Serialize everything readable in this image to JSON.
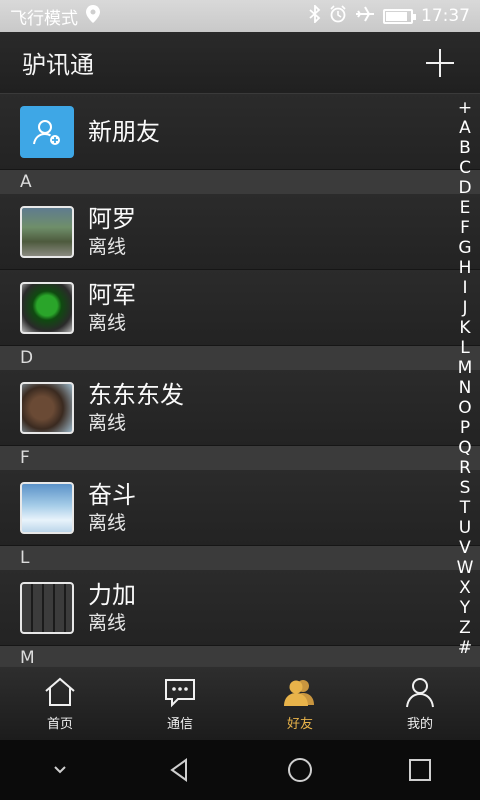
{
  "status": {
    "carrier": "飞行模式",
    "time": "17:37",
    "icons": [
      "location-icon",
      "bluetooth-icon",
      "alarm-icon",
      "airplane-icon",
      "battery-icon"
    ]
  },
  "header": {
    "title": "驴讯通",
    "add_icon": "plus-icon"
  },
  "new_friend": {
    "label": "新朋友",
    "icon": "add-friend-icon"
  },
  "sections": [
    {
      "letter": "A",
      "contacts": [
        {
          "name": "阿罗",
          "status": "离线"
        },
        {
          "name": "阿军",
          "status": "离线"
        }
      ]
    },
    {
      "letter": "D",
      "contacts": [
        {
          "name": "东东东发",
          "status": "离线"
        }
      ]
    },
    {
      "letter": "F",
      "contacts": [
        {
          "name": "奋斗",
          "status": "离线"
        }
      ]
    },
    {
      "letter": "L",
      "contacts": [
        {
          "name": "力加",
          "status": "离线"
        }
      ]
    },
    {
      "letter": "M",
      "contacts": []
    }
  ],
  "index": [
    "+",
    "A",
    "B",
    "C",
    "D",
    "E",
    "F",
    "G",
    "H",
    "I",
    "J",
    "K",
    "L",
    "M",
    "N",
    "O",
    "P",
    "Q",
    "R",
    "S",
    "T",
    "U",
    "V",
    "W",
    "X",
    "Y",
    "Z",
    "#"
  ],
  "tabs": [
    {
      "label": "首页",
      "icon": "home-icon",
      "active": false
    },
    {
      "label": "通信",
      "icon": "chat-icon",
      "active": false
    },
    {
      "label": "好友",
      "icon": "friends-icon",
      "active": true
    },
    {
      "label": "我的",
      "icon": "profile-icon",
      "active": false
    }
  ],
  "colors": {
    "accent": "#e8b34a",
    "new_friend_bg": "#3ea7e6"
  }
}
